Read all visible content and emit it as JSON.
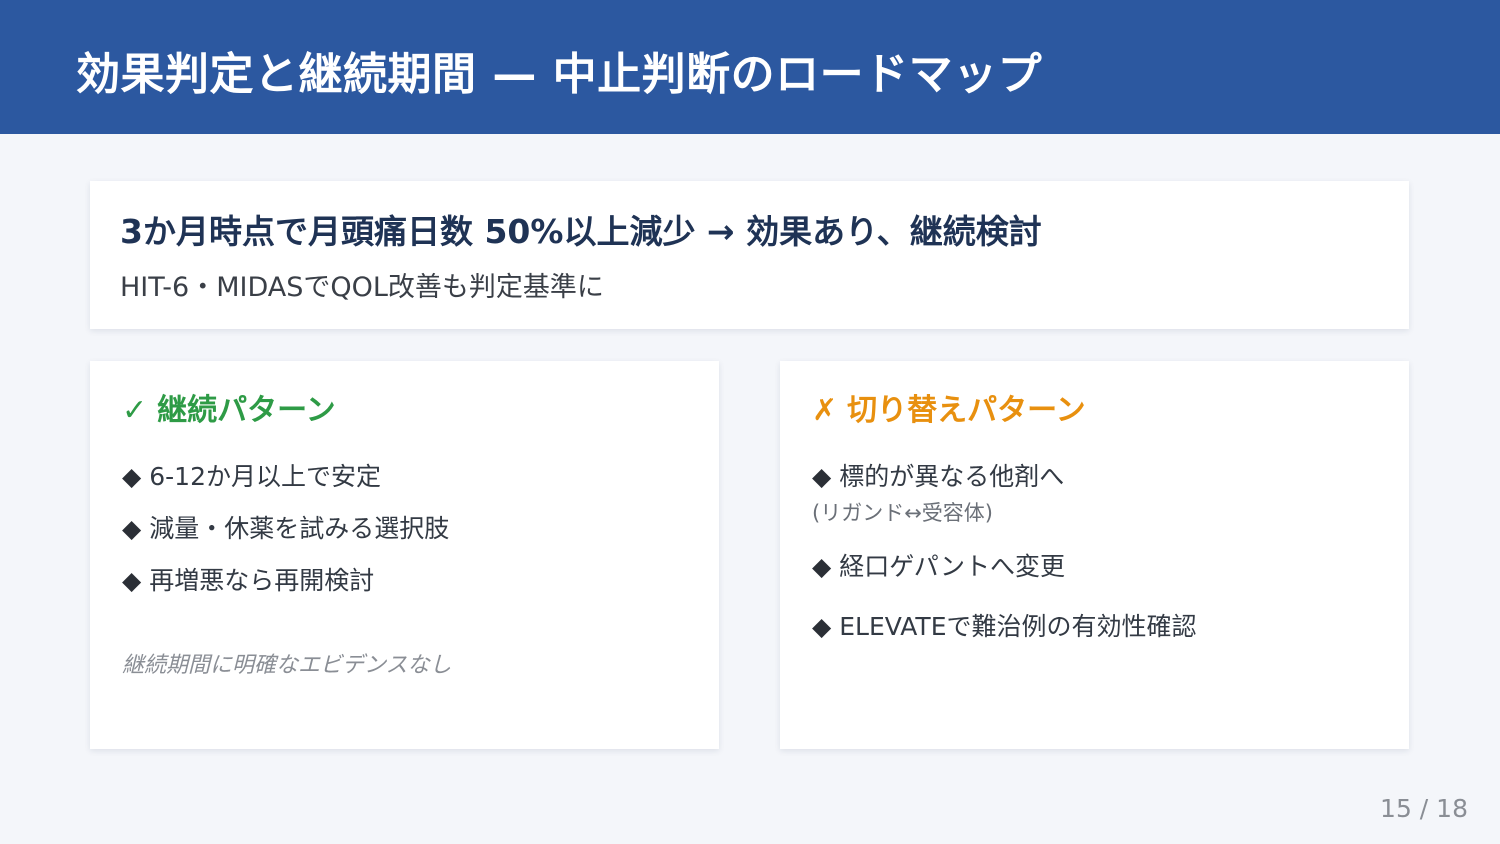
{
  "header": {
    "title": "効果判定と継続期間 — 中止判断のロードマップ"
  },
  "summary": {
    "headline": "3か月時点で月頭痛日数 50%以上減少 → 効果あり、継続検討",
    "subline": "HIT-6・MIDASでQOL改善も判定基準に"
  },
  "continue_pattern": {
    "mark": "✓",
    "title": "継続パターン",
    "items": [
      "6-12か月以上で安定",
      "減量・休薬を試みる選択肢",
      "再増悪なら再開検討"
    ],
    "note": "継続期間に明確なエビデンスなし"
  },
  "switch_pattern": {
    "mark": "✗",
    "title": "切り替えパターン",
    "items": [
      "標的が異なる他剤へ",
      "経口ゲパントへ変更",
      "ELEVATEで難治例の有効性確認"
    ],
    "item0_note": "(リガンド↔受容体)"
  },
  "bullet": "◆",
  "page_number": "15 / 18",
  "colors": {
    "header_bg": "#2c58a0",
    "continue": "#2e9b46",
    "switch": "#e8900f"
  }
}
